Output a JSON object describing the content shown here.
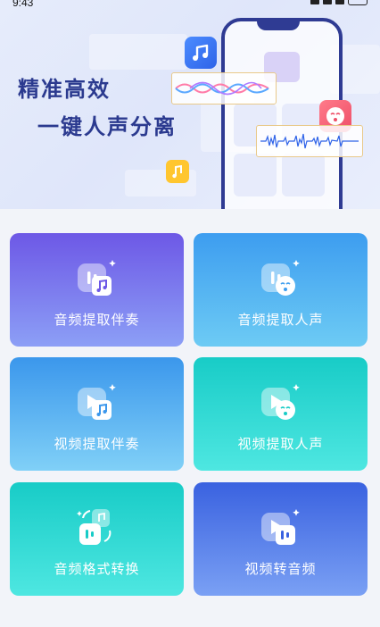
{
  "status_bar": {
    "time": "9:43"
  },
  "hero": {
    "line1": "精准高效",
    "line2": "一键人声分离"
  },
  "features": [
    {
      "label": "音频提取伴奏",
      "icon": "audio-accompaniment-icon",
      "color": "#6d58e6"
    },
    {
      "label": "音频提取人声",
      "icon": "audio-vocal-icon",
      "color": "#3d9df0"
    },
    {
      "label": "视频提取伴奏",
      "icon": "video-accompaniment-icon",
      "color": "#3b97ec"
    },
    {
      "label": "视频提取人声",
      "icon": "video-vocal-icon",
      "color": "#18ccc7"
    },
    {
      "label": "音频格式转换",
      "icon": "audio-format-convert-icon",
      "color": "#18ccc7"
    },
    {
      "label": "视频转音频",
      "icon": "video-to-audio-icon",
      "color": "#3a62e0"
    }
  ]
}
